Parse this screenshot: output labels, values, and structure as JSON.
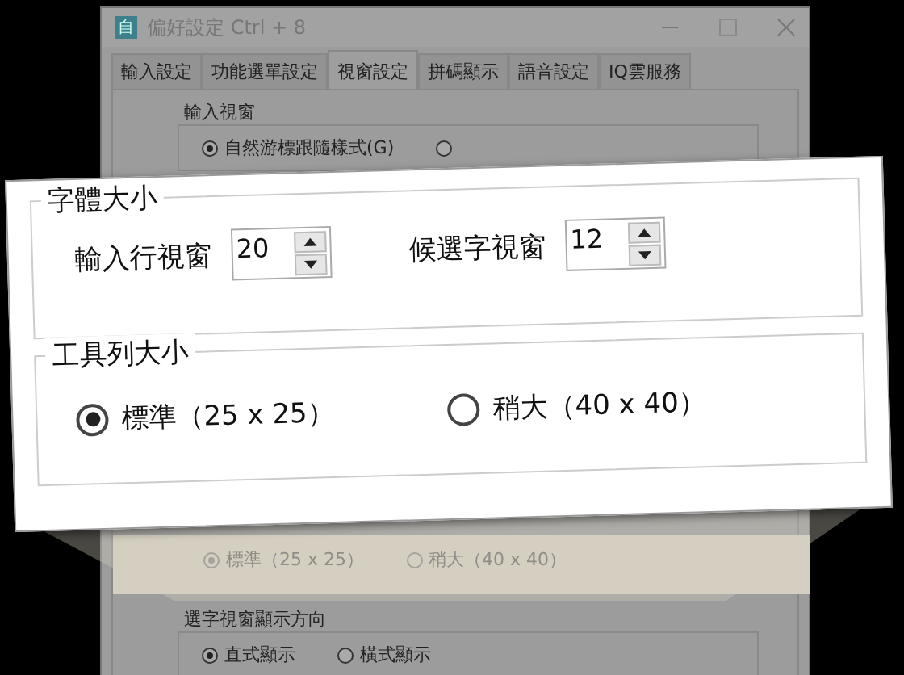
{
  "window": {
    "title": "偏好設定 Ctrl + 8",
    "app_icon": "自"
  },
  "tabs": [
    {
      "label": "輸入設定",
      "selected": false
    },
    {
      "label": "功能選單設定",
      "selected": false
    },
    {
      "label": "視窗設定",
      "selected": true
    },
    {
      "label": "拼碼顯示",
      "selected": false
    },
    {
      "label": "語音設定",
      "selected": false
    },
    {
      "label": "IQ雲服務",
      "selected": false
    }
  ],
  "input_window_group": {
    "legend": "輸入視窗",
    "options": [
      {
        "label": "自然游標跟隨樣式(G)",
        "selected": true
      },
      {
        "selected": false
      }
    ]
  },
  "toolbar_size_options": [
    {
      "label": "標準（25 x 25）",
      "selected": true
    },
    {
      "label": "稍大（40 x 40）",
      "selected": false
    }
  ],
  "direction_group": {
    "legend": "選字視窗顯示方向",
    "options": [
      {
        "label": "直式顯示",
        "selected": true
      },
      {
        "label": "橫式顯示",
        "selected": false
      }
    ]
  },
  "callout": {
    "font_group": {
      "legend": "字體大小",
      "fields": [
        {
          "label": "輸入行視窗",
          "value": "20"
        },
        {
          "label": "候選字視窗",
          "value": "12"
        }
      ]
    },
    "toolbar_group": {
      "legend": "工具列大小",
      "options": [
        {
          "label": "標準（25 x 25）",
          "selected": true
        },
        {
          "label": "稍大（40 x 40）",
          "selected": false
        }
      ]
    }
  }
}
